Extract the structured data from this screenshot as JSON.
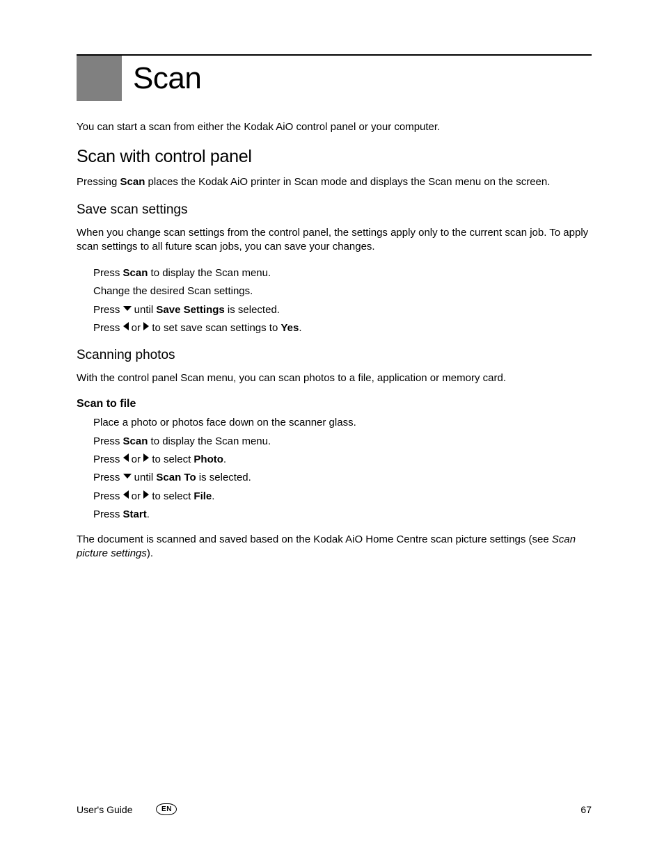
{
  "chapter": {
    "title": "Scan"
  },
  "intro": "You can start a scan from either the Kodak AiO control panel or your computer.",
  "section1": {
    "heading": "Scan with control panel",
    "body_pre": "Pressing ",
    "body_bold": "Scan",
    "body_post": " places the Kodak AiO printer in Scan mode and displays the Scan menu on the screen."
  },
  "save_scan": {
    "heading": "Save scan settings",
    "body": "When you change scan settings from the control panel, the settings apply only to the current scan job. To apply scan settings to all future scan jobs, you can save your changes.",
    "step1_pre": "Press ",
    "step1_bold": "Scan",
    "step1_post": " to display the Scan menu.",
    "step2": "Change the desired Scan settings.",
    "step3_pre": "Press ",
    "step3_mid": " until ",
    "step3_bold": "Save Settings",
    "step3_post": " is selected.",
    "step4_pre": "Press ",
    "step4_or": " or ",
    "step4_mid": " to set save scan settings to ",
    "step4_bold": "Yes",
    "step4_post": "."
  },
  "scanning_photos": {
    "heading": "Scanning photos",
    "body": "With the control panel Scan menu, you can scan photos to a file, application or memory card."
  },
  "scan_to_file": {
    "heading": "Scan to file",
    "step1": "Place a photo or photos face down on the scanner glass.",
    "step2_pre": "Press ",
    "step2_bold": "Scan",
    "step2_post": " to display the Scan menu.",
    "step3_pre": "Press ",
    "step3_or": " or ",
    "step3_mid": " to select ",
    "step3_bold": "Photo",
    "step3_post": ".",
    "step4_pre": "Press ",
    "step4_mid": " until ",
    "step4_bold": "Scan To",
    "step4_post": " is selected.",
    "step5_pre": "Press ",
    "step5_or": " or ",
    "step5_mid": " to select ",
    "step5_bold": "File",
    "step5_post": ".",
    "step6_pre": "Press ",
    "step6_bold": "Start",
    "step6_post": "."
  },
  "closing": {
    "pre": "The document is scanned and saved based on the Kodak AiO Home Centre scan picture settings (see ",
    "italic": "Scan picture settings",
    "post": ")."
  },
  "footer": {
    "guide": "User's Guide",
    "lang": "EN",
    "page": "67"
  }
}
